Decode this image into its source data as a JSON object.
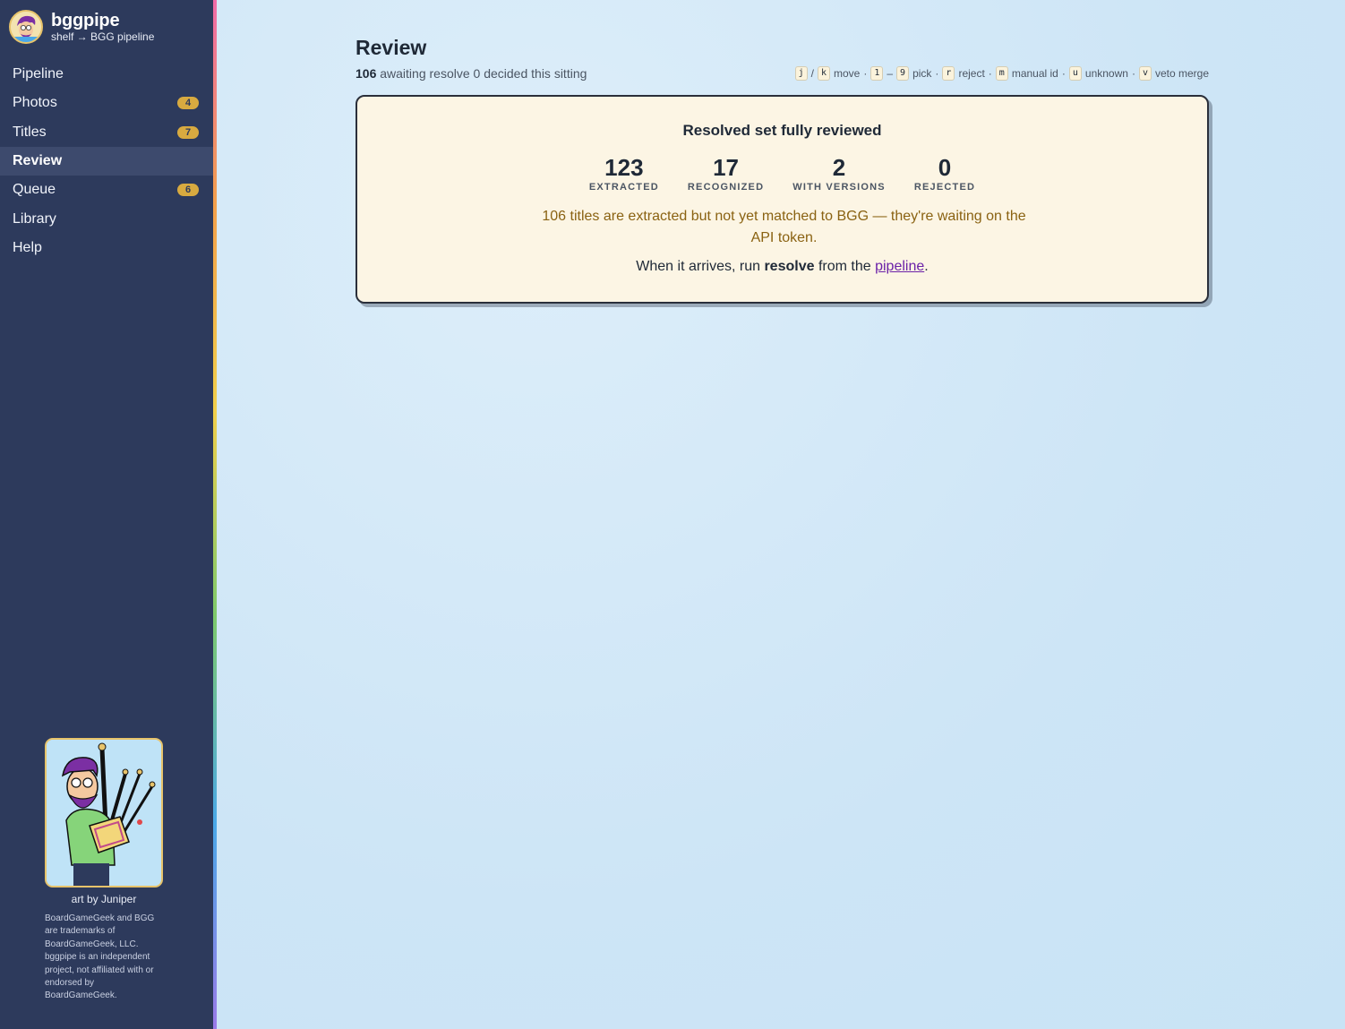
{
  "brand": {
    "name": "bggpipe",
    "subtitle": "shelf → BGG pipeline"
  },
  "nav": [
    {
      "label": "Pipeline",
      "badge": ""
    },
    {
      "label": "Photos",
      "badge": "4"
    },
    {
      "label": "Titles",
      "badge": "7"
    },
    {
      "label": "Review",
      "badge": "",
      "active": true
    },
    {
      "label": "Queue",
      "badge": "6"
    },
    {
      "label": "Library",
      "badge": ""
    },
    {
      "label": "Help",
      "badge": ""
    }
  ],
  "sidebar_footer": {
    "art_credit": "art by Juniper",
    "disclaimer": "BoardGameGeek and BGG are trademarks of BoardGameGeek, LLC. bggpipe is an independent project, not affiliated with or endorsed by BoardGameGeek."
  },
  "page": {
    "title": "Review",
    "awaiting_count": "106",
    "awaiting_text": "awaiting resolve",
    "decided_text": "0 decided this sitting"
  },
  "shortcuts": {
    "move_keys": [
      "j",
      "k"
    ],
    "move_sep": "/",
    "move_label": "move",
    "pick_keys": [
      "1",
      "9"
    ],
    "pick_sep": "–",
    "pick_label": "pick",
    "reject_key": "r",
    "reject_label": "reject",
    "manual_key": "m",
    "manual_label": "manual id",
    "unknown_key": "u",
    "unknown_label": "unknown",
    "veto_key": "v",
    "veto_label": "veto merge",
    "dot": "·"
  },
  "card": {
    "title": "Resolved set fully reviewed",
    "stats": [
      {
        "value": "123",
        "label": "EXTRACTED"
      },
      {
        "value": "17",
        "label": "RECOGNIZED"
      },
      {
        "value": "2",
        "label": "WITH VERSIONS"
      },
      {
        "value": "0",
        "label": "REJECTED"
      }
    ],
    "waiting_text": "106 titles are extracted but not yet matched to BGG — they're waiting on the API token.",
    "hint_prefix": "When it arrives, run",
    "hint_bold": "resolve",
    "hint_mid": "from the",
    "hint_link": "pipeline",
    "hint_suffix": "."
  },
  "colors": {
    "sidebar": "#2d3a5c",
    "badge": "#d8aa40",
    "card_bg": "#fcf5e4",
    "warning_text": "#8a6212",
    "link": "#6b21a8"
  }
}
